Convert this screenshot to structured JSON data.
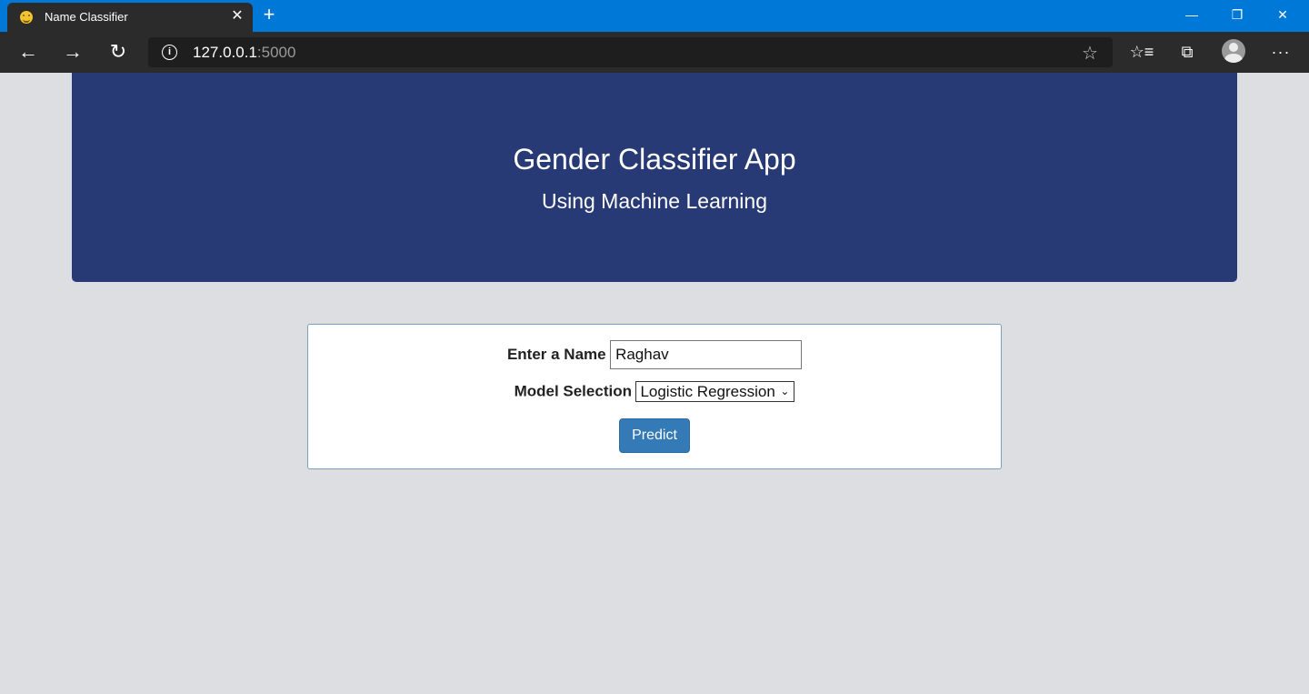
{
  "browser": {
    "tab_title": "Name Classifier",
    "url_host": "127.0.0.1",
    "url_port": ":5000",
    "icons": {
      "favicon": "smiley-icon",
      "tab_close": "close-icon",
      "new_tab": "plus-icon",
      "back": "arrow-left-icon",
      "forward": "arrow-right-icon",
      "reload": "reload-icon",
      "info": "info-icon",
      "favorite": "star-icon",
      "favorites_list": "favorites-list-icon",
      "collections": "collections-icon",
      "profile": "profile-avatar-icon",
      "more": "more-dots-icon"
    },
    "colors": {
      "titlebar": "#0078d7",
      "toolbar": "#2b2b2b"
    }
  },
  "header": {
    "title": "Gender Classifier App",
    "subtitle": "Using Machine Learning",
    "background": "#273a75"
  },
  "form": {
    "name_label": "Enter a Name",
    "name_value": "Raghav",
    "model_label": "Model Selection",
    "model_selected": "Logistic Regression",
    "submit_label": "Predict",
    "button_color": "#337ab7"
  }
}
